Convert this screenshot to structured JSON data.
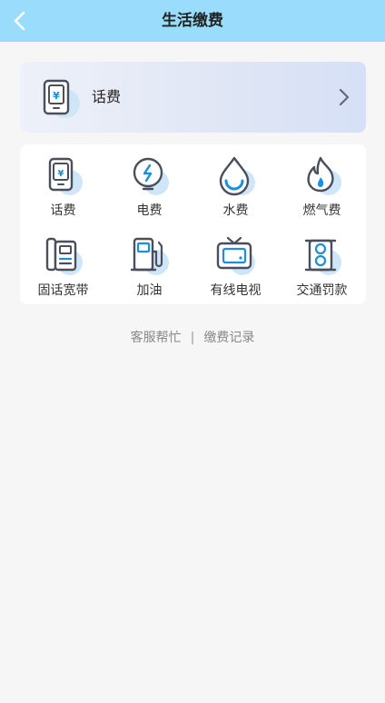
{
  "header": {
    "title": "生活缴费",
    "back_icon": "chevron-left-icon"
  },
  "featured": {
    "label": "话费",
    "icon": "phone-bill-icon"
  },
  "services": [
    {
      "label": "话费",
      "icon": "phone-bill-icon"
    },
    {
      "label": "电费",
      "icon": "electricity-icon"
    },
    {
      "label": "水费",
      "icon": "water-drop-icon"
    },
    {
      "label": "燃气费",
      "icon": "gas-flame-icon"
    },
    {
      "label": "固话宽带",
      "icon": "landline-icon"
    },
    {
      "label": "加油",
      "icon": "fuel-pump-icon"
    },
    {
      "label": "有线电视",
      "icon": "tv-icon"
    },
    {
      "label": "交通罚款",
      "icon": "traffic-light-icon"
    }
  ],
  "links": {
    "service_help": "客服帮忙",
    "separator": "|",
    "payment_records": "缴费记录"
  },
  "colors": {
    "header_bg": "#99dcfb",
    "icon_stroke": "#4a4f5c",
    "icon_accent": "#1a8fe0",
    "icon_shadow": "#cfe6f8"
  }
}
